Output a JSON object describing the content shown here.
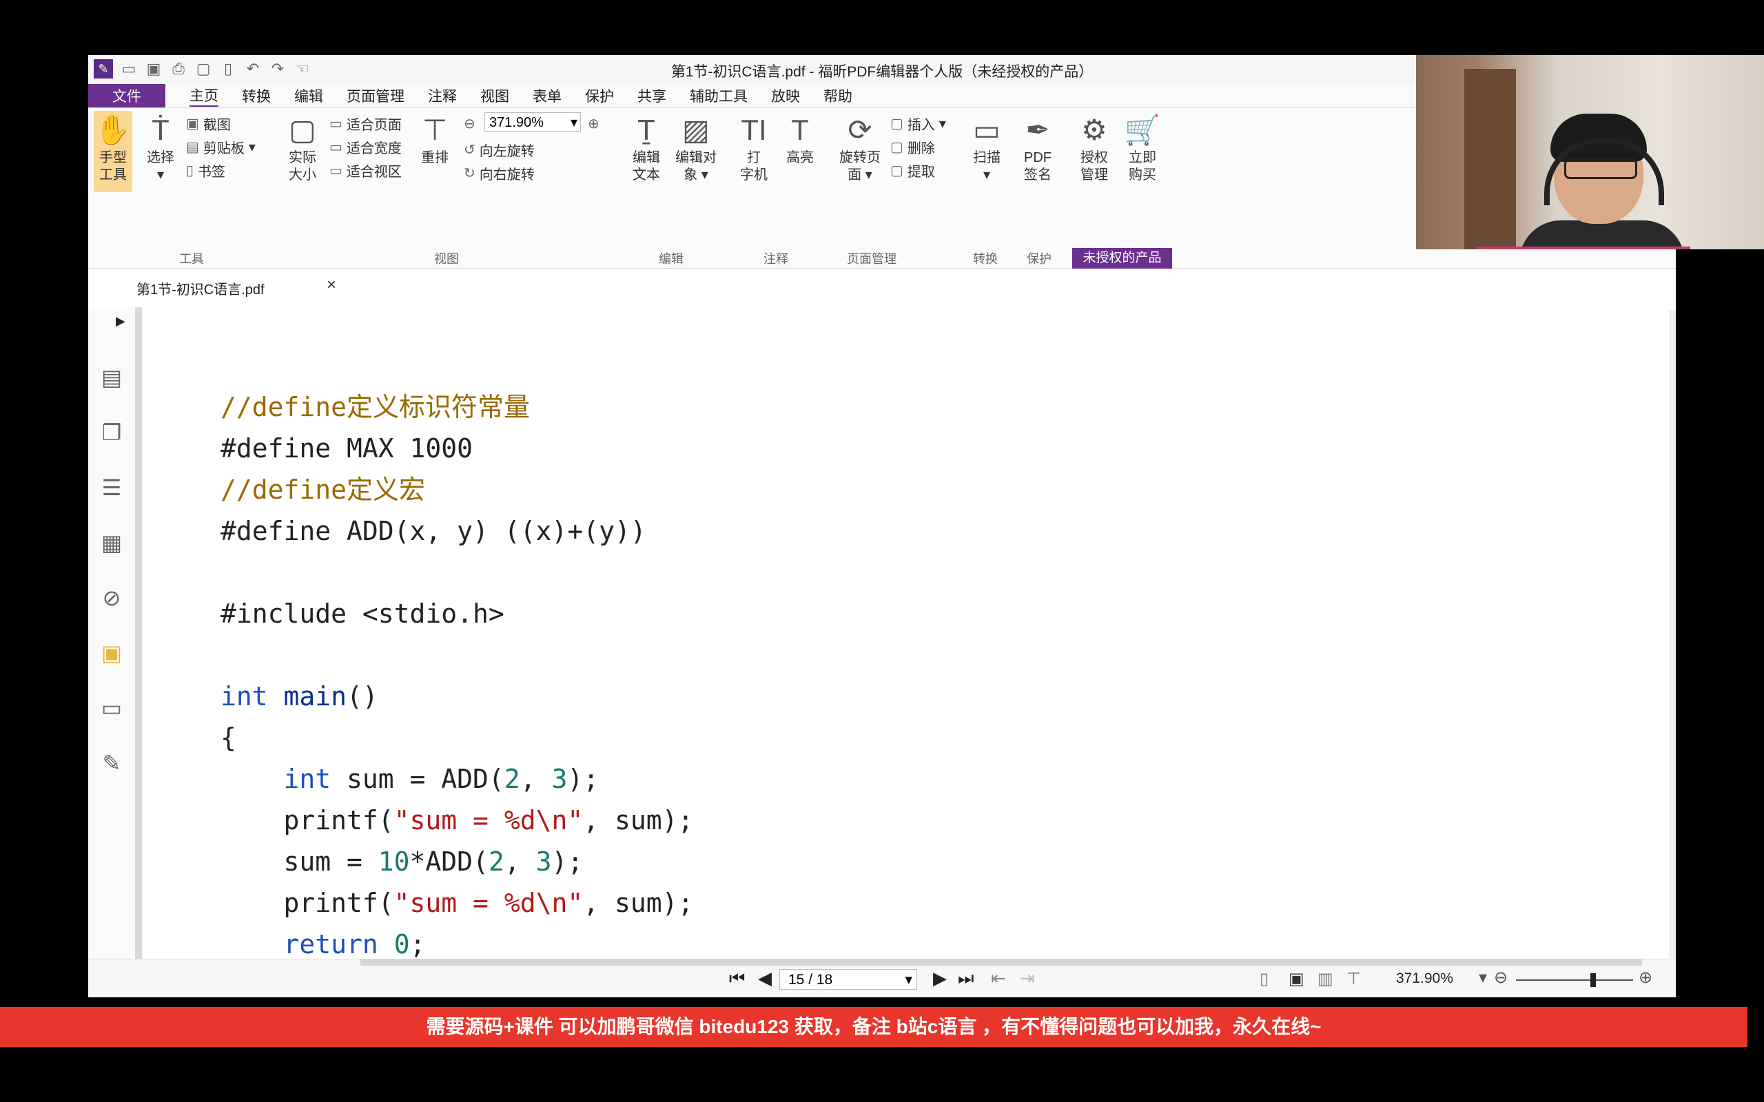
{
  "window": {
    "title": "第1节-初识C语言.pdf - 福昕PDF编辑器个人版（未经授权的产品）"
  },
  "quick_access": [
    "save-icon",
    "print-icon",
    "page-icon",
    "new-icon",
    "undo-icon",
    "redo-icon",
    "hand-icon"
  ],
  "menu": {
    "file": "文件",
    "items": [
      "主页",
      "转换",
      "编辑",
      "页面管理",
      "注释",
      "视图",
      "表单",
      "保护",
      "共享",
      "辅助工具",
      "放映",
      "帮助"
    ]
  },
  "ribbon": {
    "hand_tool": [
      "手型",
      "工具"
    ],
    "select": "选择",
    "snapshot": "截图",
    "clipboard": "剪贴板",
    "bookmark": "书签",
    "actual_size": [
      "实际",
      "大小"
    ],
    "fit_page": "适合页面",
    "fit_width": "适合宽度",
    "fit_visible": "适合视区",
    "reflow": "重排",
    "zoom_value": "371.90%",
    "rotate_left": "向左旋转",
    "rotate_right": "向右旋转",
    "edit_text": [
      "编辑",
      "文本"
    ],
    "edit_object": [
      "编辑对",
      "象"
    ],
    "typewriter": [
      "打",
      "字机"
    ],
    "highlight": "高亮",
    "rotate_page": [
      "旋转页",
      "面"
    ],
    "insert": "插入",
    "delete": "删除",
    "extract": "提取",
    "scan": "扫描",
    "pdf_sign": [
      "PDF",
      "签名"
    ],
    "license_mgmt": [
      "授权",
      "管理"
    ],
    "buy_now": [
      "立即",
      "购买"
    ],
    "unauthorized": "未授权的产品",
    "groups": {
      "tools": "工具",
      "view": "视图",
      "edit": "编辑",
      "annotate": "注释",
      "page_mgmt": "页面管理",
      "convert": "转换",
      "protect": "保护"
    }
  },
  "tab": {
    "name": "第1节-初识C语言.pdf",
    "close": "×"
  },
  "code_lines": [
    {
      "spans": [
        {
          "c": "cmt",
          "t": "//define定义标识符常量"
        }
      ]
    },
    {
      "spans": [
        {
          "c": "",
          "t": "#define MAX 1000"
        }
      ]
    },
    {
      "spans": [
        {
          "c": "cmt",
          "t": "//define定义宏"
        }
      ]
    },
    {
      "spans": [
        {
          "c": "",
          "t": "#define ADD(x, y) ((x)+(y))"
        }
      ]
    },
    {
      "spans": []
    },
    {
      "spans": [
        {
          "c": "",
          "t": "#include <stdio.h>"
        }
      ]
    },
    {
      "spans": []
    },
    {
      "spans": [
        {
          "c": "kw",
          "t": "int"
        },
        {
          "c": "",
          "t": " "
        },
        {
          "c": "fn",
          "t": "main"
        },
        {
          "c": "",
          "t": "()"
        }
      ]
    },
    {
      "spans": [
        {
          "c": "",
          "t": "{"
        }
      ]
    },
    {
      "spans": [
        {
          "c": "",
          "t": "    "
        },
        {
          "c": "kw",
          "t": "int"
        },
        {
          "c": "",
          "t": " sum = ADD("
        },
        {
          "c": "num",
          "t": "2"
        },
        {
          "c": "",
          "t": ", "
        },
        {
          "c": "num",
          "t": "3"
        },
        {
          "c": "",
          "t": ");"
        }
      ]
    },
    {
      "spans": [
        {
          "c": "",
          "t": "    printf("
        },
        {
          "c": "str",
          "t": "\"sum = %d\\n\""
        },
        {
          "c": "",
          "t": ", sum);"
        }
      ]
    },
    {
      "spans": [
        {
          "c": "",
          "t": "    sum = "
        },
        {
          "c": "num",
          "t": "10"
        },
        {
          "c": "",
          "t": "*ADD("
        },
        {
          "c": "num",
          "t": "2"
        },
        {
          "c": "",
          "t": ", "
        },
        {
          "c": "num",
          "t": "3"
        },
        {
          "c": "",
          "t": ");"
        }
      ]
    },
    {
      "spans": [
        {
          "c": "",
          "t": "    printf("
        },
        {
          "c": "str",
          "t": "\"sum = %d\\n\""
        },
        {
          "c": "",
          "t": ", sum);"
        }
      ]
    },
    {
      "spans": [
        {
          "c": "",
          "t": "    "
        },
        {
          "c": "kw",
          "t": "return"
        },
        {
          "c": "",
          "t": " "
        },
        {
          "c": "num",
          "t": "0"
        },
        {
          "c": "",
          "t": ";"
        }
      ]
    },
    {
      "spans": [
        {
          "c": "",
          "t": "}"
        }
      ]
    }
  ],
  "status": {
    "page_indicator": "15 / 18",
    "zoom": "371.90%"
  },
  "banner": {
    "text": "需要源码+课件 可以加鹏哥微信 bitedu123 获取，备注 b站c语言 ，有不懂得问题也可以加我，永久在线~"
  },
  "colors": {
    "brand": "#6a2f8f",
    "banner": "#e8362c",
    "highlight": "#fbd794"
  }
}
